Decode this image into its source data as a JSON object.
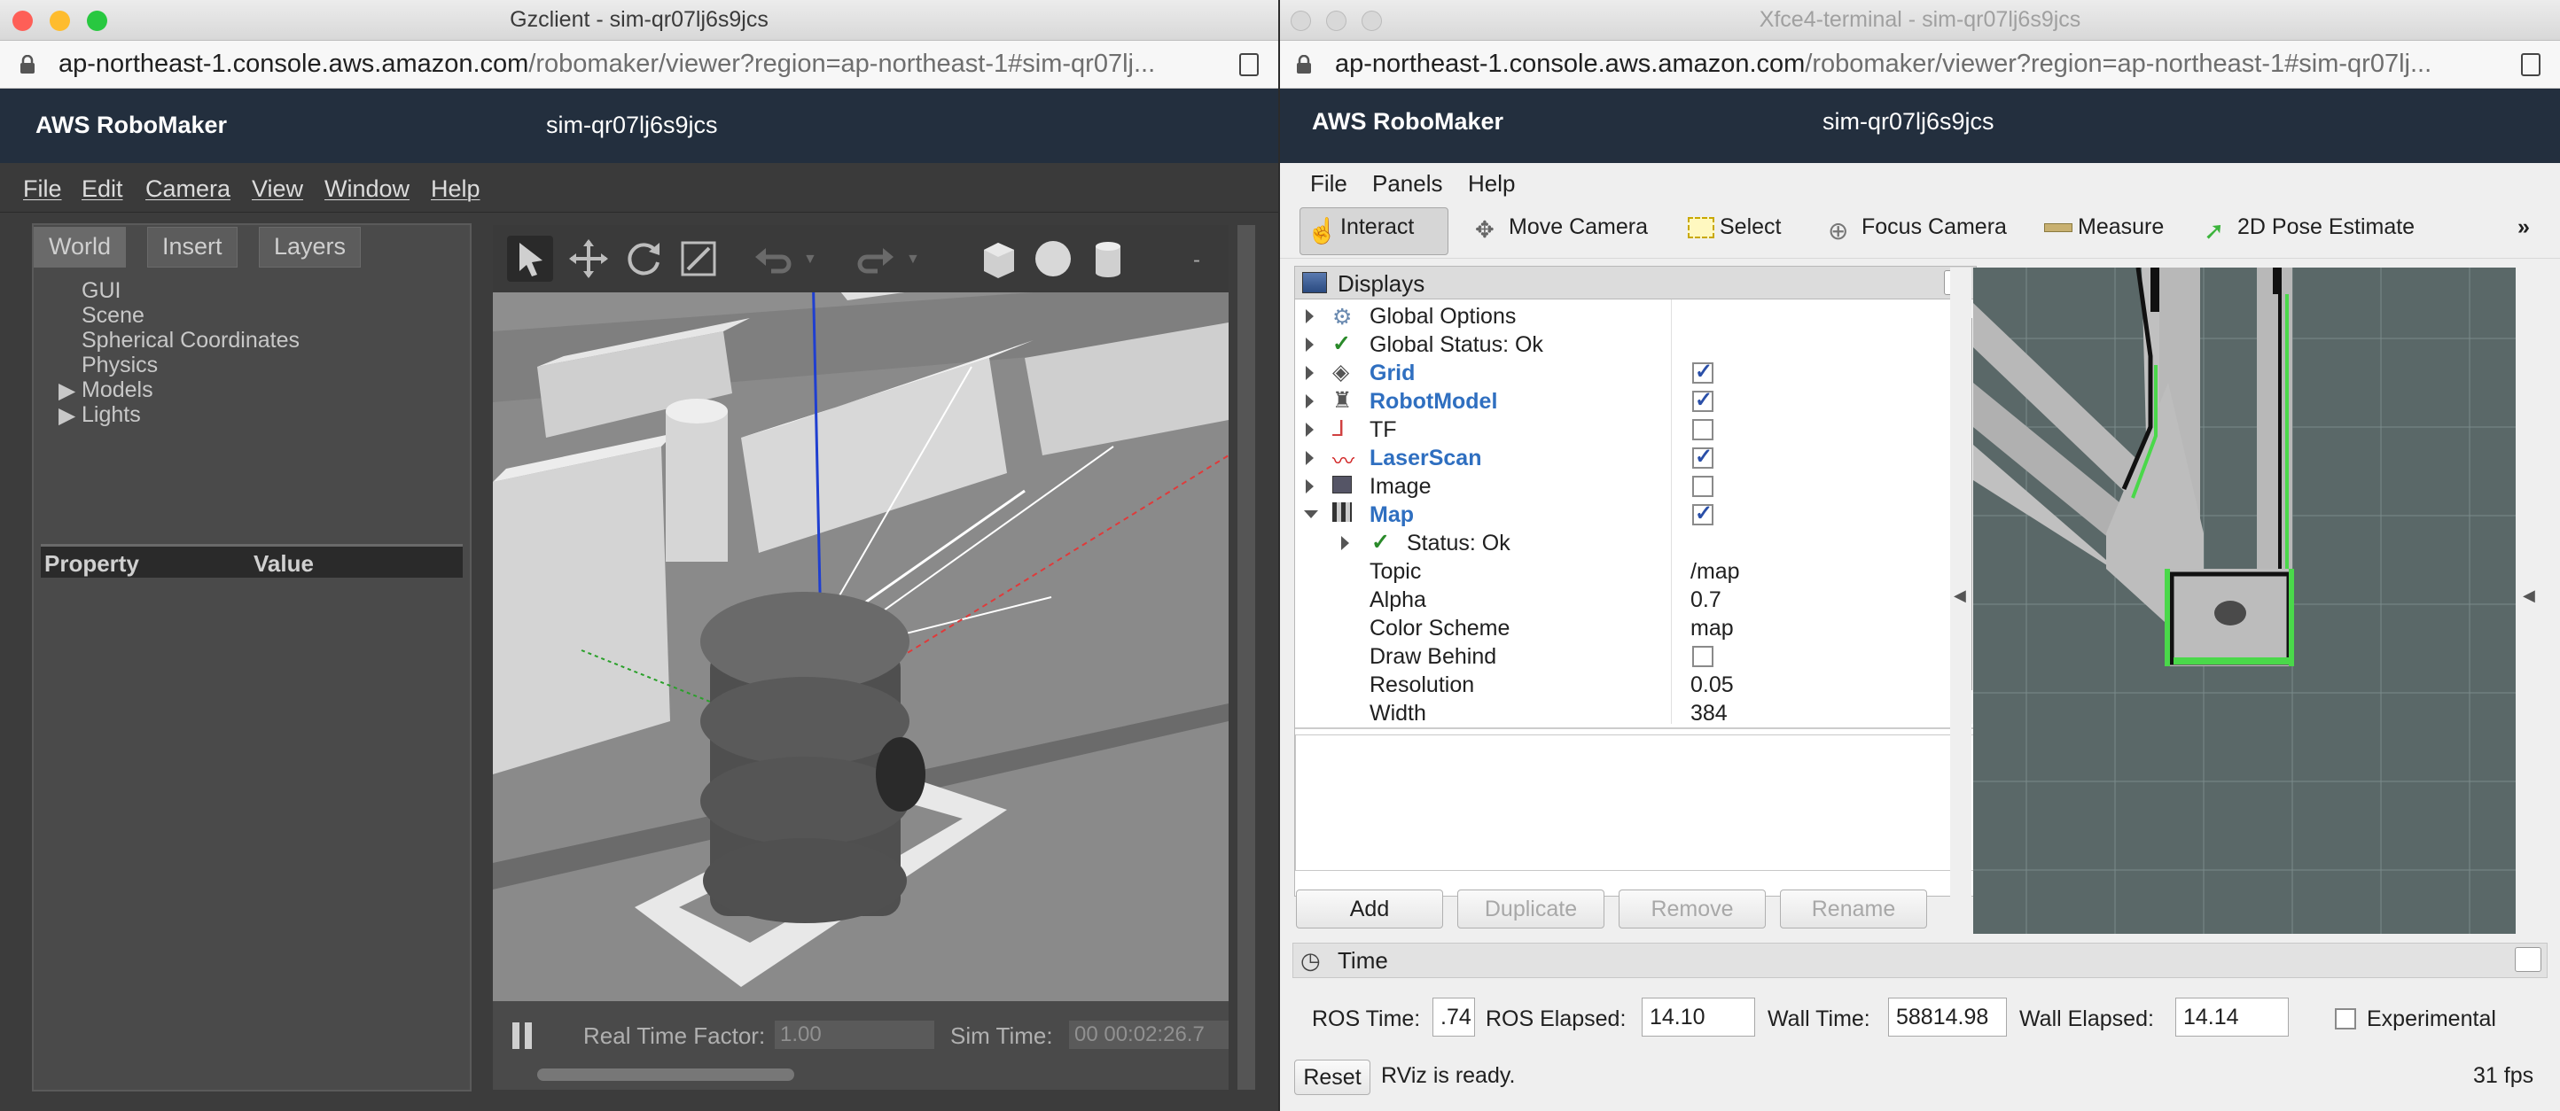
{
  "gazebo_window": {
    "title": "Gzclient - sim-qr07lj6s9jcs",
    "url_host": "ap-northeast-1.console.aws.amazon.com",
    "url_path": "/robomaker/viewer?region=ap-northeast-1#sim-qr07lj...",
    "brand": "AWS RoboMaker",
    "sim_name": "sim-qr07lj6s9jcs",
    "menu": [
      "File",
      "Edit",
      "Camera",
      "View",
      "Window",
      "Help"
    ],
    "tabs": [
      "World",
      "Insert",
      "Layers"
    ],
    "tree": [
      "GUI",
      "Scene",
      "Spherical Coordinates",
      "Physics",
      "Models",
      "Lights"
    ],
    "property_header": "Property",
    "value_header": "Value",
    "real_time_factor_label": "Real Time Factor:",
    "real_time_factor": "1.00",
    "sim_time_label": "Sim Time:",
    "sim_time": "00 00:02:26.7"
  },
  "rviz_window": {
    "title": "Xfce4-terminal - sim-qr07lj6s9jcs",
    "url_host": "ap-northeast-1.console.aws.amazon.com",
    "url_path": "/robomaker/viewer?region=ap-northeast-1#sim-qr07lj...",
    "brand": "AWS RoboMaker",
    "sim_name": "sim-qr07lj6s9jcs",
    "menu": [
      "File",
      "Panels",
      "Help"
    ],
    "tools": [
      "Interact",
      "Move Camera",
      "Select",
      "Focus Camera",
      "Measure",
      "2D Pose Estimate"
    ],
    "displays_title": "Displays",
    "displays": [
      {
        "name": "Global Options",
        "checked": null,
        "highlight": false
      },
      {
        "name": "Global Status: Ok",
        "checked": null,
        "highlight": false
      },
      {
        "name": "Grid",
        "checked": true,
        "highlight": true
      },
      {
        "name": "RobotModel",
        "checked": true,
        "highlight": true
      },
      {
        "name": "TF",
        "checked": false,
        "highlight": false
      },
      {
        "name": "LaserScan",
        "checked": true,
        "highlight": true
      },
      {
        "name": "Image",
        "checked": false,
        "highlight": false
      },
      {
        "name": "Map",
        "checked": true,
        "highlight": true
      }
    ],
    "map_status": "Status: Ok",
    "map_props": [
      {
        "name": "Topic",
        "value": "/map"
      },
      {
        "name": "Alpha",
        "value": "0.7"
      },
      {
        "name": "Color Scheme",
        "value": "map"
      },
      {
        "name": "Draw Behind",
        "value": ""
      },
      {
        "name": "Resolution",
        "value": "0.05"
      },
      {
        "name": "Width",
        "value": "384"
      }
    ],
    "buttons": [
      "Add",
      "Duplicate",
      "Remove",
      "Rename"
    ],
    "time_title": "Time",
    "ros_time_label": "ROS Time:",
    "ros_time": ".74",
    "ros_elapsed_label": "ROS Elapsed:",
    "ros_elapsed": "14.10",
    "wall_time_label": "Wall Time:",
    "wall_time": "58814.98",
    "wall_elapsed_label": "Wall Elapsed:",
    "wall_elapsed": "14.14",
    "experimental_label": "Experimental",
    "reset_label": "Reset",
    "status_text": "RViz is ready.",
    "fps": "31 fps"
  }
}
